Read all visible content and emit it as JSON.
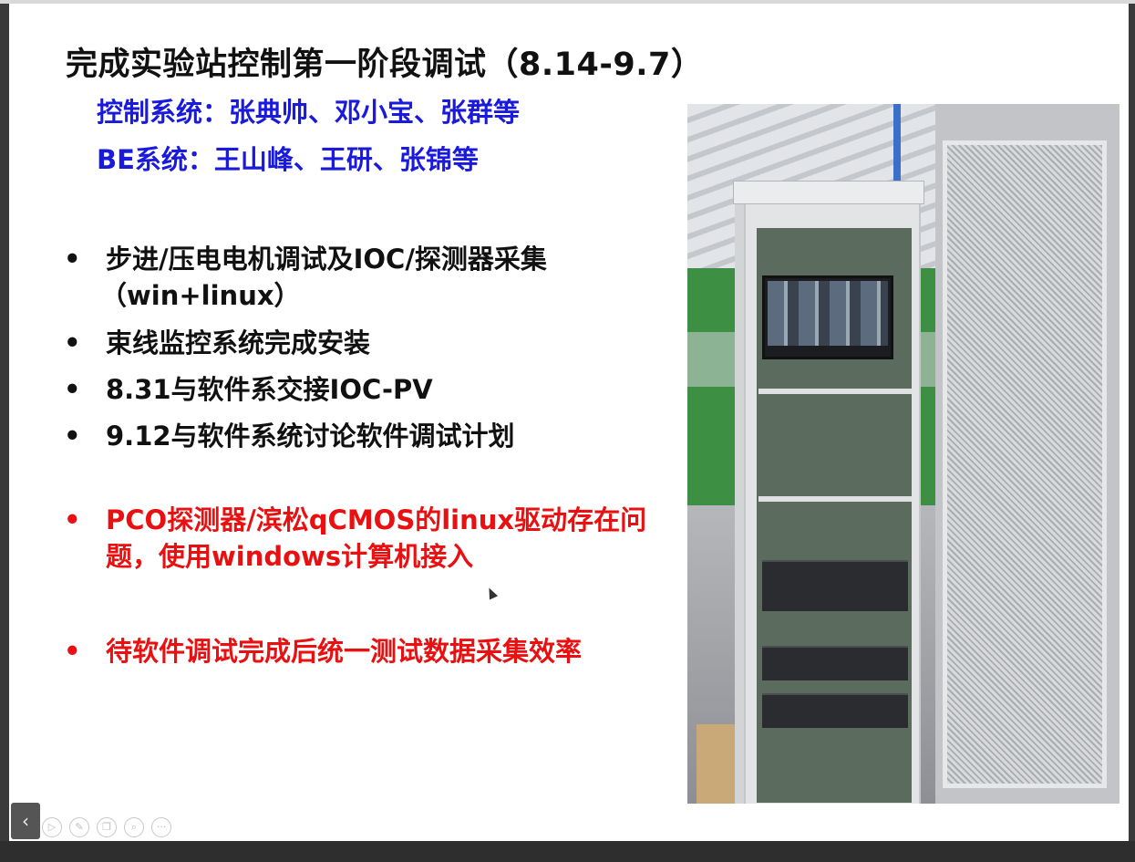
{
  "slide": {
    "title": "完成实验站控制第一阶段调试（8.14-9.7）",
    "team_lines": [
      "控制系统：张典帅、邓小宝、张群等",
      "BE系统：王山峰、王研、张锦等"
    ],
    "bullet_marker": "•",
    "bullets": [
      {
        "text": "步进/压电电机调试及IOC/探测器采集",
        "sub": "（win+linux）",
        "color": "#111111"
      },
      {
        "text": "束线监控系统完成安装",
        "color": "#111111"
      },
      {
        "text": "8.31与软件系交接IOC-PV",
        "color": "#111111"
      },
      {
        "text": "9.12与软件系统讨论软件调试计划",
        "color": "#111111"
      },
      {
        "text": "PCO探测器/滨松qCMOS的linux驱动存在问题，使用windows计算机接入",
        "color": "#e81010"
      },
      {
        "text": "待软件调试完成后统一测试数据采集效率",
        "color": "#e81010"
      }
    ],
    "photo": {
      "subject": "server-rack-cabinet-photo"
    }
  },
  "toolbar": {
    "nav_prev_label": "‹",
    "tools": [
      {
        "icon": "play-icon",
        "glyph": "▷"
      },
      {
        "icon": "pen-icon",
        "glyph": "✎"
      },
      {
        "icon": "copy-icon",
        "glyph": "❐"
      },
      {
        "icon": "zoom-icon",
        "glyph": "⌕"
      },
      {
        "icon": "more-icon",
        "glyph": "···"
      }
    ]
  },
  "colors": {
    "title": "#111111",
    "team": "#1a1adc",
    "highlight": "#e81010"
  }
}
